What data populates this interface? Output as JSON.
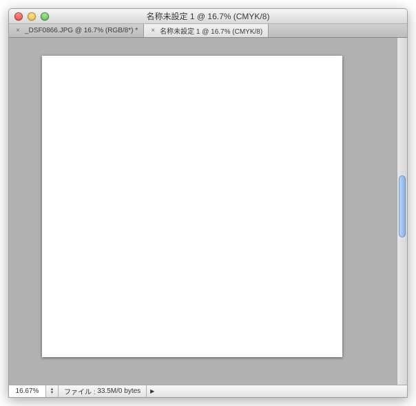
{
  "window": {
    "title": "名称未設定 1 @ 16.7% (CMYK/8)"
  },
  "tabs": [
    {
      "label": "_DSF0866.JPG @ 16.7% (RGB/8*) *",
      "active": false
    },
    {
      "label": "名称未設定 1 @ 16.7% (CMYK/8)",
      "active": true
    }
  ],
  "status": {
    "zoom": "16.67%",
    "file_label": "ファイル :",
    "file_value": "33.5M/0 bytes"
  }
}
